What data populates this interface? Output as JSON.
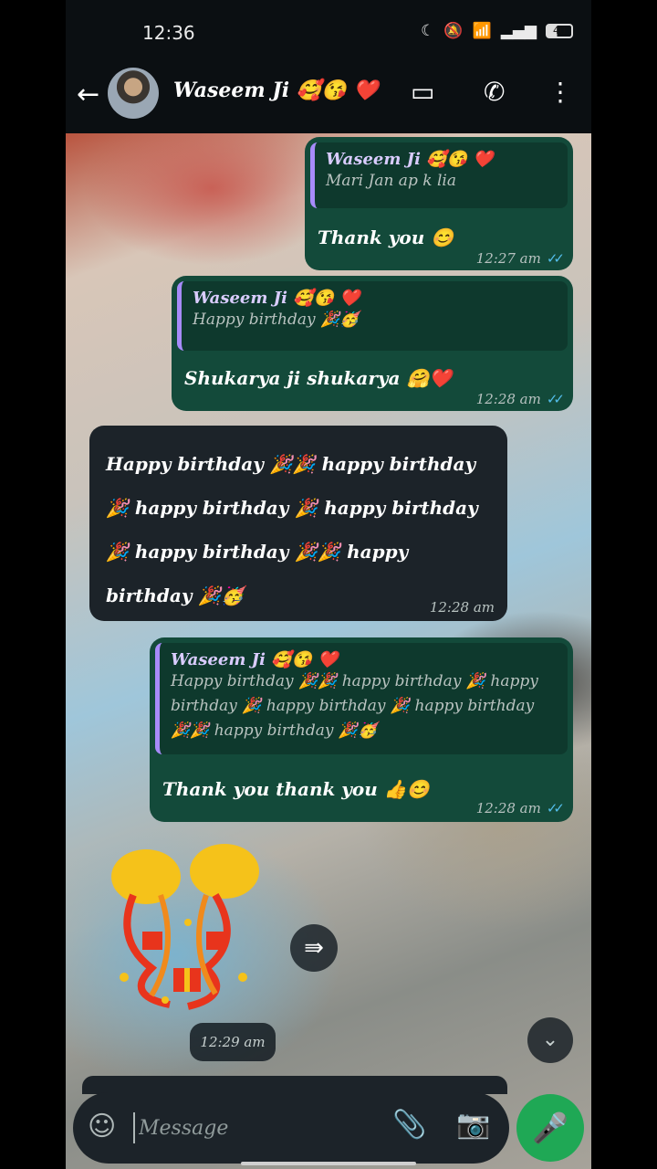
{
  "status_bar": {
    "time": "12:36",
    "moon": "☾",
    "mute": "🔕",
    "wifi": "📶",
    "signal": "▂▄▆",
    "battery": "40"
  },
  "header": {
    "back_icon": "←",
    "contact_name": "Waseem Ji 🥰😘 ❤️",
    "video_icon": "▭",
    "call_icon": "✆",
    "menu_icon": "⋮"
  },
  "messages": [
    {
      "dir": "out",
      "quote_name": "Waseem Ji 🥰😘 ❤️",
      "quote_text": "Mari Jan ap k lia",
      "text": "Thank you 😊",
      "time": "12:27 am",
      "ticks": "✓✓"
    },
    {
      "dir": "out",
      "quote_name": "Waseem Ji 🥰😘 ❤️",
      "quote_text": "Happy birthday 🎉🥳",
      "text": "Shukarya ji shukarya 🤗❤️",
      "time": "12:28 am",
      "ticks": "✓✓"
    },
    {
      "dir": "in",
      "lines": [
        "Happy birthday 🎉🎉 happy birthday",
        "🎉 happy birthday 🎉 happy birthday",
        "🎉 happy birthday 🎉🎉 happy",
        "birthday 🎉🥳"
      ],
      "time": "12:28 am"
    },
    {
      "dir": "out",
      "quote_name": "Waseem Ji 🥰😘 ❤️",
      "quote_lines": [
        "Happy birthday 🎉🎉 happy birthday 🎉 happy",
        "birthday 🎉 happy birthday 🎉 happy birthday",
        "🎉🎉 happy birthday 🎉🥳"
      ],
      "text": "Thank you thank you 👍😊",
      "time": "12:28 am",
      "ticks": "✓✓"
    }
  ],
  "sticker": {
    "emoji": "🎊",
    "time": "12:29 am"
  },
  "forward_icon": "⇛",
  "scroll_down_icon": "⌄",
  "composer": {
    "emoji_icon": "☺",
    "placeholder": "Message",
    "attach_icon": "📎",
    "camera_icon": "📷",
    "mic_icon": "🎤"
  }
}
